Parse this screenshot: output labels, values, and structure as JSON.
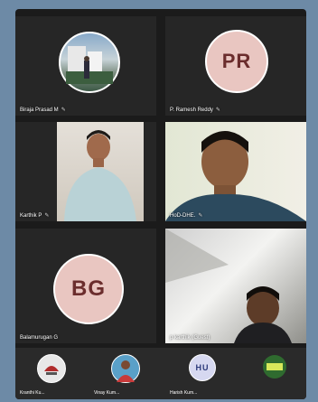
{
  "participants": [
    {
      "name": "Biraja Prasad M",
      "mic_icon": "mic-muted-icon"
    },
    {
      "name": "P. Ramesh Reddy",
      "initials": "PR",
      "mic_icon": "mic-muted-icon"
    },
    {
      "name": "Karthik P",
      "mic_icon": "mic-muted-icon"
    },
    {
      "name": "HoD-DHE.",
      "mic_icon": "mic-muted-icon"
    },
    {
      "name": "Balamurugan G",
      "initials": "BG"
    },
    {
      "name": "p karthik (Guest)"
    }
  ],
  "strip": [
    {
      "name": "Kranthi Ku..."
    },
    {
      "name": "Vinay Kum..."
    },
    {
      "name": "Harish Kum...",
      "initials": "HU"
    },
    {
      "name": ""
    }
  ],
  "colors": {
    "background": "#6d8aa6",
    "tile": "#262626",
    "initials_fill": "#e9c6c1",
    "initials_text": "#6b2d2d"
  }
}
